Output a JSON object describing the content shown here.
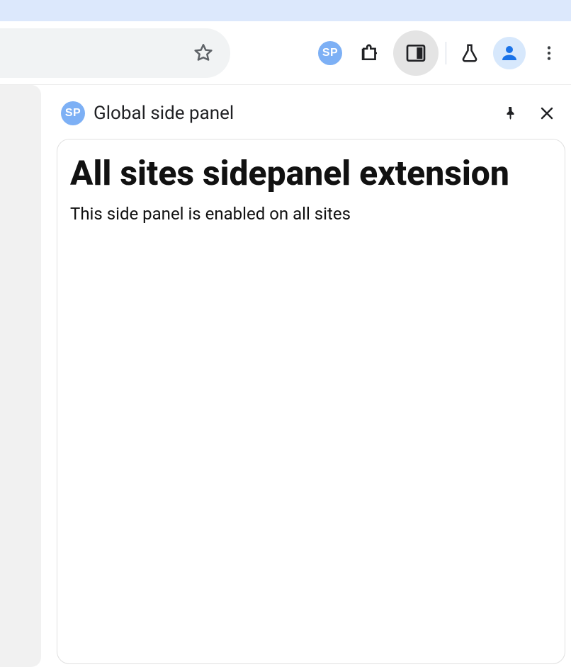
{
  "toolbar": {
    "sp_badge_text": "SP"
  },
  "sidepanel": {
    "badge_text": "SP",
    "title": "Global side panel",
    "content": {
      "heading": "All sites sidepanel extension",
      "description": "This side panel is enabled on all sites"
    }
  }
}
